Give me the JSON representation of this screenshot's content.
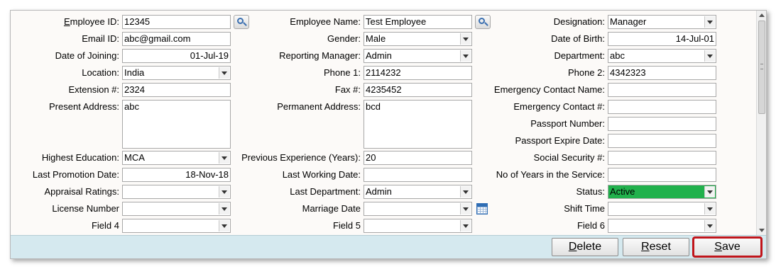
{
  "form": {
    "employee_id": {
      "label": "Employee ID:",
      "label_first": "E",
      "label_rest": "mployee ID:",
      "value": "12345"
    },
    "employee_name": {
      "label": "Employee Name:",
      "value": "Test Employee"
    },
    "designation": {
      "label": "Designation:",
      "value": "Manager"
    },
    "email_id": {
      "label": "Email ID:",
      "value": "abc@gmail.com"
    },
    "gender": {
      "label": "Gender:",
      "value": "Male"
    },
    "date_of_birth": {
      "label": "Date of Birth:",
      "value": "14-Jul-01"
    },
    "date_of_joining": {
      "label": "Date of Joining:",
      "value": "01-Jul-19"
    },
    "reporting_manager": {
      "label": "Reporting Manager:",
      "value": "Admin"
    },
    "department": {
      "label": "Department:",
      "value": "abc"
    },
    "location": {
      "label": "Location:",
      "value": "India"
    },
    "phone1": {
      "label": "Phone 1:",
      "value": "2114232"
    },
    "phone2": {
      "label": "Phone 2:",
      "value": "4342323"
    },
    "extension": {
      "label": "Extension #:",
      "value": "2324"
    },
    "fax": {
      "label": "Fax #:",
      "value": "4235452"
    },
    "emergency_contact_name": {
      "label": "Emergency Contact Name:",
      "value": ""
    },
    "present_address": {
      "label": "Present Address:",
      "value": "abc"
    },
    "permanent_address": {
      "label": "Permanent Address:",
      "value": "bcd"
    },
    "emergency_contact_no": {
      "label": "Emergency Contact #:",
      "value": ""
    },
    "passport_number": {
      "label": "Passport Number:",
      "value": ""
    },
    "passport_expire_date": {
      "label": "Passport Expire Date:",
      "value": ""
    },
    "highest_education": {
      "label": "Highest Education:",
      "value": "MCA"
    },
    "previous_experience": {
      "label": "Previous Experience (Years):",
      "value": "20"
    },
    "social_security": {
      "label": "Social Security #:",
      "value": ""
    },
    "last_promotion_date": {
      "label": "Last Promotion Date:",
      "value": "18-Nov-18"
    },
    "last_working_date": {
      "label": "Last Working Date:",
      "value": ""
    },
    "years_in_service": {
      "label": "No of Years in the Service:",
      "value": ""
    },
    "appraisal_ratings": {
      "label": "Appraisal Ratings:",
      "value": ""
    },
    "last_department": {
      "label": "Last Department:",
      "value": "Admin"
    },
    "status": {
      "label": "Status:",
      "value": "Active",
      "color": "#21b14c"
    },
    "license_number": {
      "label": "License Number",
      "value": ""
    },
    "marriage_date": {
      "label": "Marriage Date",
      "value": ""
    },
    "shift_time": {
      "label": "Shift Time",
      "value": ""
    },
    "field4": {
      "label": "Field 4",
      "value": ""
    },
    "field5": {
      "label": "Field 5",
      "value": ""
    },
    "field6": {
      "label": "Field 6",
      "value": ""
    }
  },
  "buttons": {
    "delete": {
      "first": "D",
      "rest": "elete"
    },
    "reset": {
      "first": "R",
      "rest": "eset"
    },
    "save": {
      "first": "S",
      "rest": "ave"
    }
  },
  "icons": {
    "search": "magnifier-icon",
    "calendar": "calendar-icon"
  },
  "colors": {
    "footer_bar": "#d5e9ef",
    "save_highlight": "#c0151b",
    "status_active": "#21b14c"
  }
}
